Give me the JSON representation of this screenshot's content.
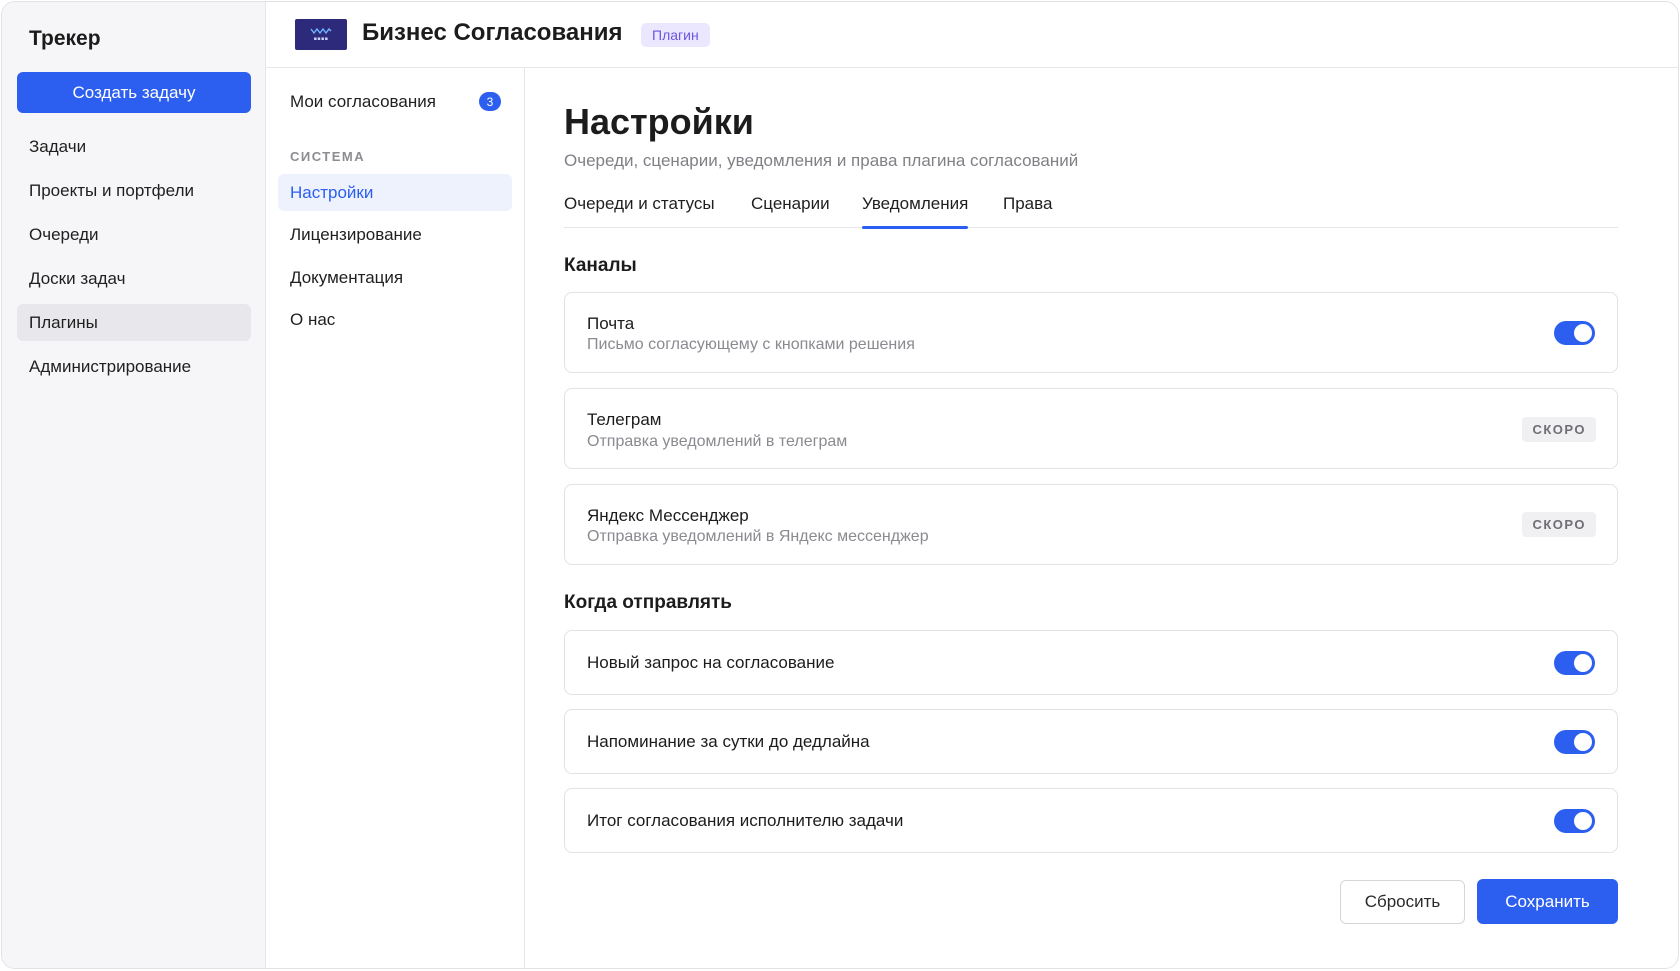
{
  "sidebar": {
    "title": "Трекер",
    "create_button": "Создать задачу",
    "items": [
      {
        "label": "Задачи"
      },
      {
        "label": "Проекты и портфели"
      },
      {
        "label": "Очереди"
      },
      {
        "label": "Доски задач"
      },
      {
        "label": "Плагины",
        "active": true
      },
      {
        "label": "Администрирование"
      }
    ]
  },
  "header": {
    "title": "Бизнес Согласования",
    "badge": "Плагин",
    "logo_icon": "company-logo-icon"
  },
  "subnav": {
    "my_approvals": {
      "label": "Мои согласования",
      "count": "3"
    },
    "section_label": "СИСТЕМА",
    "items": [
      {
        "label": "Настройки",
        "active": true
      },
      {
        "label": "Лицензирование"
      },
      {
        "label": "Документация"
      },
      {
        "label": "О нас"
      }
    ]
  },
  "main": {
    "title": "Настройки",
    "subtitle": "Очереди, сценарии, уведомления и права плагина согласований",
    "tabs": [
      {
        "label": "Очереди и статусы"
      },
      {
        "label": "Сценарии"
      },
      {
        "label": "Уведомления",
        "active": true
      },
      {
        "label": "Права"
      }
    ],
    "channels": {
      "title": "Каналы",
      "items": [
        {
          "title": "Почта",
          "description": "Письмо согласующему с кнопками решения",
          "enabled": true
        },
        {
          "title": "Телеграм",
          "description": "Отправка уведомлений в телеграм",
          "status": "СКОРО"
        },
        {
          "title": "Яндекс Мессенджер",
          "description": "Отправка уведомлений в Яндекс мессенджер",
          "status": "СКОРО"
        }
      ]
    },
    "when_to_send": {
      "title": "Когда отправлять",
      "items": [
        {
          "title": "Новый запрос на согласование",
          "enabled": true
        },
        {
          "title": "Напоминание за сутки до дедлайна",
          "enabled": true
        },
        {
          "title": "Итог согласования исполнителю задачи",
          "enabled": true
        }
      ]
    },
    "actions": {
      "reset_label": "Сбросить",
      "save_label": "Сохранить"
    }
  },
  "colors": {
    "accent": "#2c5ef0",
    "badge_bg": "#ebe7ff",
    "badge_text": "#6b55e0"
  }
}
